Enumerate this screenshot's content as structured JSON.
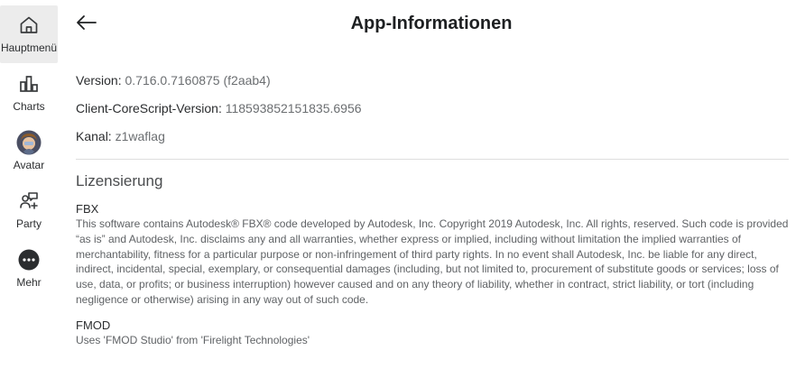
{
  "sidebar": {
    "items": [
      {
        "label": "Hauptmenü",
        "icon": "home-icon",
        "active": true
      },
      {
        "label": "Charts",
        "icon": "charts-icon",
        "active": false
      },
      {
        "label": "Avatar",
        "icon": "avatar-icon",
        "active": false
      },
      {
        "label": "Party",
        "icon": "party-icon",
        "active": false
      },
      {
        "label": "Mehr",
        "icon": "more-icon",
        "active": false
      }
    ]
  },
  "header": {
    "back_icon": "back-arrow-icon",
    "title": "App-Informationen"
  },
  "info": {
    "version_label": "Version:",
    "version_value": "0.716.0.7160875 (f2aab4)",
    "corescript_label": "Client-CoreScript-Version:",
    "corescript_value": "118593852151835.6956",
    "channel_label": "Kanal:",
    "channel_value": "z1waflag"
  },
  "licensing": {
    "title": "Lizensierung",
    "entries": [
      {
        "name": "FBX",
        "text": "This software contains Autodesk® FBX® code developed by Autodesk, Inc. Copyright 2019 Autodesk, Inc. All rights, reserved. Such code is provided “as is” and Autodesk, Inc. disclaims any and all warranties, whether express or implied, including without limitation the implied warranties of merchantability, fitness for a particular purpose or non-infringement of third party rights. In no event shall Autodesk, Inc. be liable for any direct, indirect, incidental, special, exemplary, or consequential damages (including, but not limited to, procurement of substitute goods or services; loss of use, data, or profits; or business interruption) however caused and on any theory of liability, whether in contract, strict liability, or tort (including negligence or otherwise) arising in any way out of such code."
      },
      {
        "name": "FMOD",
        "text": "Uses 'FMOD Studio' from 'Firelight Technologies'"
      }
    ]
  },
  "colors": {
    "active_nav_bg": "#ececec",
    "divider": "#dedede",
    "title_text": "#1e2022"
  }
}
